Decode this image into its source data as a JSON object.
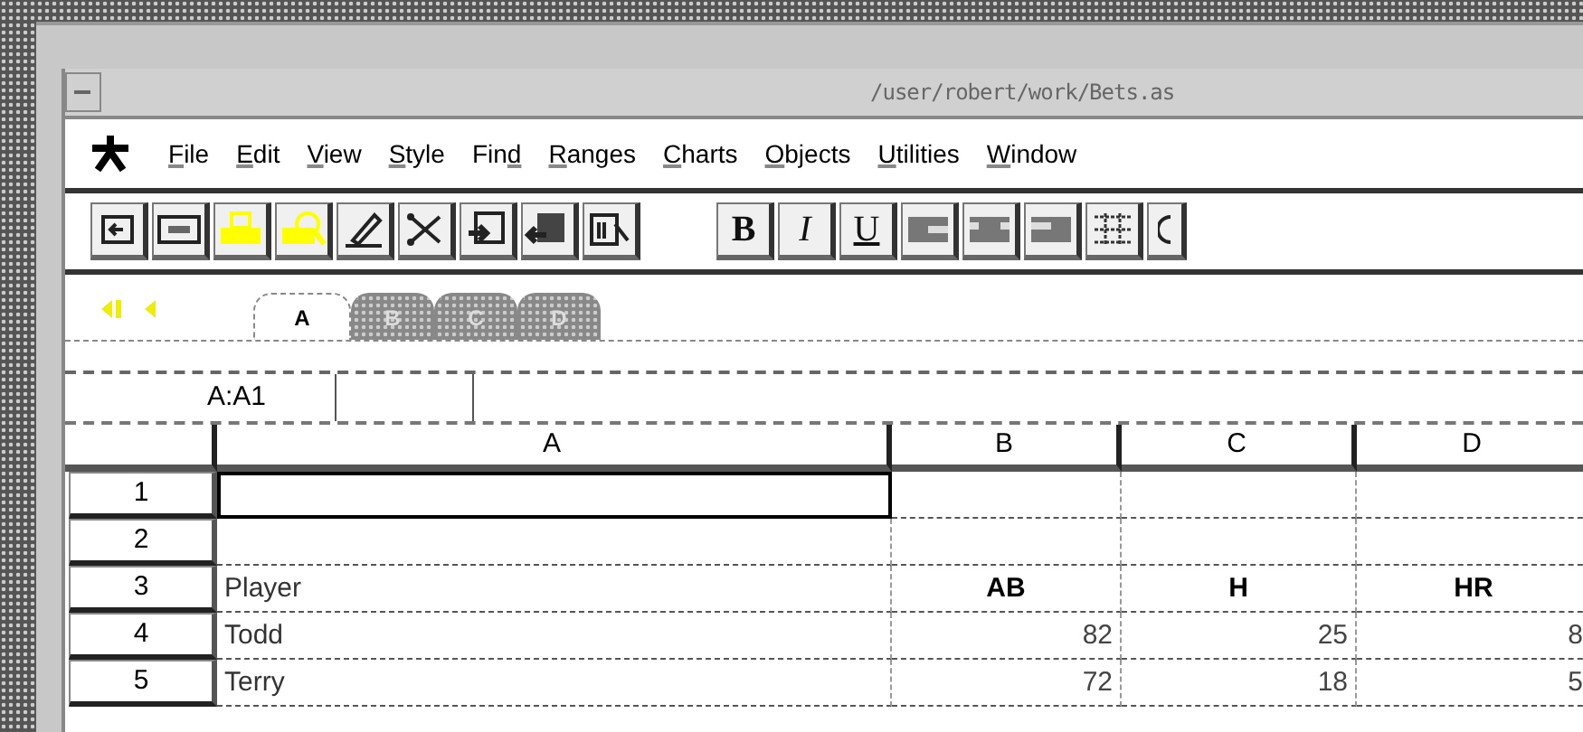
{
  "window": {
    "title": "/user/robert/work/Bets.as"
  },
  "menu_items": [
    {
      "key": "F",
      "after": "ile"
    },
    {
      "key": "E",
      "after": "dit"
    },
    {
      "key": "V",
      "after": "iew"
    },
    {
      "key": "S",
      "after": "tyle"
    },
    {
      "before": "Fin",
      "key": "d"
    },
    {
      "key": "R",
      "after": "anges"
    },
    {
      "key": "C",
      "after": "harts"
    },
    {
      "key": "O",
      "after": "bjects"
    },
    {
      "key": "U",
      "after": "tilities"
    },
    {
      "key": "W",
      "after": "indow"
    }
  ],
  "toolbar": [
    {
      "kind": "navigate"
    },
    {
      "kind": "window"
    },
    {
      "kind": "print"
    },
    {
      "kind": "preview"
    },
    {
      "kind": "pen"
    },
    {
      "kind": "scissors"
    },
    {
      "kind": "copy"
    },
    {
      "kind": "paste"
    },
    {
      "kind": "select"
    },
    {
      "kind": "spacer"
    },
    {
      "kind": "bold",
      "label": "B"
    },
    {
      "kind": "italic",
      "label": "I"
    },
    {
      "kind": "underline",
      "label": "U"
    },
    {
      "kind": "align-left"
    },
    {
      "kind": "align-center"
    },
    {
      "kind": "align-right"
    },
    {
      "kind": "grid"
    },
    {
      "kind": "partial"
    }
  ],
  "sheet_tabs": [
    {
      "label": "A",
      "selected": true
    },
    {
      "label": "B",
      "selected": false
    },
    {
      "label": "C",
      "selected": false
    },
    {
      "label": "D",
      "selected": false
    }
  ],
  "cell_reference": "A:A1",
  "columns": [
    "A",
    "B",
    "C",
    "D"
  ],
  "rows": [
    {
      "number": "1",
      "cells": [
        {
          "selected": true
        },
        {
          "selected": false
        },
        {
          "selected": false
        },
        {
          "selected": false
        }
      ]
    },
    {
      "number": "2",
      "cells": [
        {
          "selected": false
        },
        {
          "selected": false
        },
        {
          "selected": false
        },
        {
          "selected": false
        }
      ]
    },
    {
      "number": "3",
      "cells": [
        {
          "text": "Player",
          "kind": "label",
          "selected": false
        },
        {
          "text": "AB",
          "kind": "heading",
          "selected": false
        },
        {
          "text": "H",
          "kind": "heading",
          "selected": false
        },
        {
          "text": "HR",
          "kind": "heading",
          "selected": false
        }
      ]
    },
    {
      "number": "4",
      "cells": [
        {
          "text": "Todd",
          "kind": "label",
          "selected": false
        },
        {
          "text": "82",
          "kind": "number",
          "selected": false
        },
        {
          "text": "25",
          "kind": "number",
          "selected": false
        },
        {
          "text": "8",
          "kind": "number",
          "selected": false
        }
      ]
    },
    {
      "number": "5",
      "cells": [
        {
          "text": "Terry",
          "kind": "label",
          "selected": false
        },
        {
          "text": "72",
          "kind": "number",
          "selected": false
        },
        {
          "text": "18",
          "kind": "number",
          "selected": false
        },
        {
          "text": "5",
          "kind": "number",
          "selected": false
        }
      ]
    }
  ]
}
